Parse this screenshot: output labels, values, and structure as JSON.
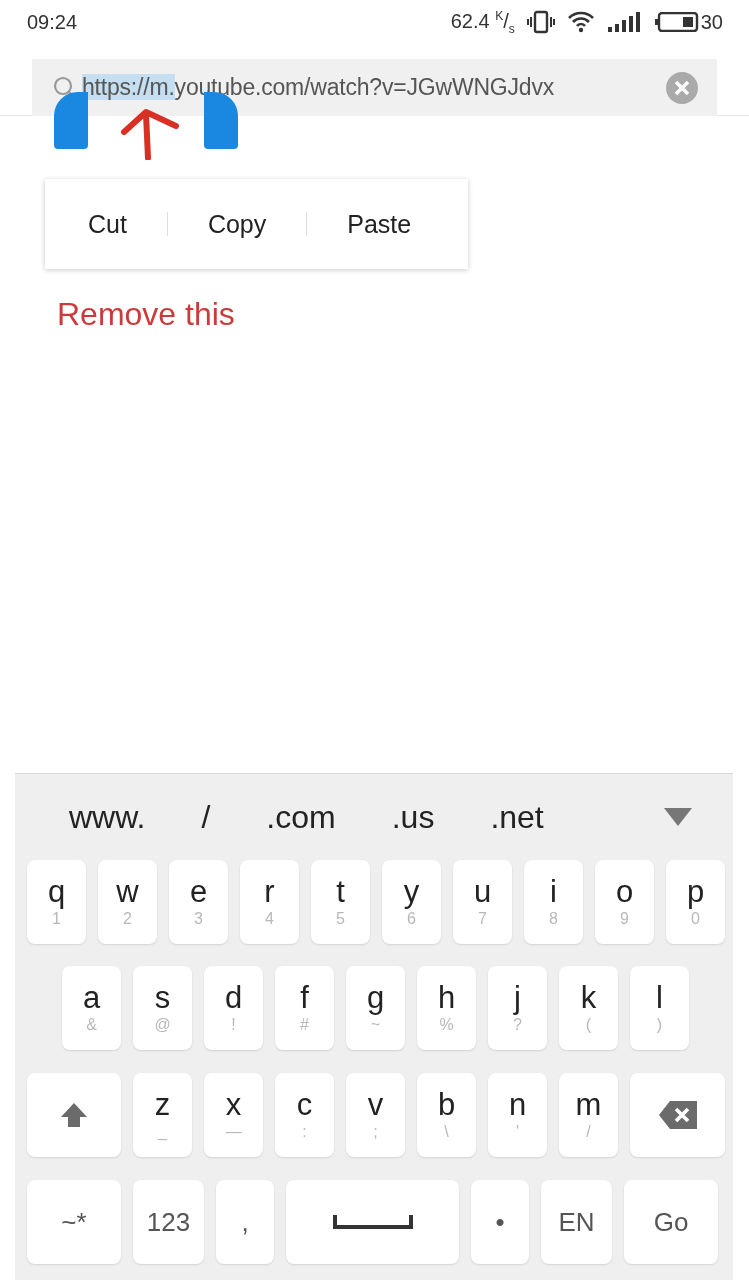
{
  "status_bar": {
    "time": "09:24",
    "speed": "62.4 $^{K}$/$_{s}$",
    "battery": "30"
  },
  "address_bar": {
    "segments": [
      {
        "text": "https://m.",
        "selected": true
      },
      {
        "text": "youtube.com/watch?v=JGwWNGJdvx",
        "selected": false
      }
    ]
  },
  "context_menu": [
    "Cut",
    "Copy",
    "Paste"
  ],
  "annotation": "Remove this",
  "keyboard": {
    "suggestions": [
      "www.",
      "/",
      ".com",
      ".us",
      ".net"
    ],
    "rows": [
      {
        "keys": [
          {
            "kind": "letter",
            "main": "q",
            "sub": "1"
          },
          {
            "kind": "letter",
            "main": "w",
            "sub": "2"
          },
          {
            "kind": "letter",
            "main": "e",
            "sub": "3"
          },
          {
            "kind": "letter",
            "main": "r",
            "sub": "4"
          },
          {
            "kind": "letter",
            "main": "t",
            "sub": "5"
          },
          {
            "kind": "letter",
            "main": "y",
            "sub": "6"
          },
          {
            "kind": "letter",
            "main": "u",
            "sub": "7"
          },
          {
            "kind": "letter",
            "main": "i",
            "sub": "8"
          },
          {
            "kind": "letter",
            "main": "o",
            "sub": "9"
          },
          {
            "kind": "letter",
            "main": "p",
            "sub": "0"
          }
        ]
      },
      {
        "keys": [
          {
            "kind": "letter",
            "main": "a",
            "sub": "&"
          },
          {
            "kind": "letter",
            "main": "s",
            "sub": "@"
          },
          {
            "kind": "letter",
            "main": "d",
            "sub": "!"
          },
          {
            "kind": "letter",
            "main": "f",
            "sub": "#"
          },
          {
            "kind": "letter",
            "main": "g",
            "sub": "~"
          },
          {
            "kind": "letter",
            "main": "h",
            "sub": "%"
          },
          {
            "kind": "letter",
            "main": "j",
            "sub": "?"
          },
          {
            "kind": "letter",
            "main": "k",
            "sub": "("
          },
          {
            "kind": "letter",
            "main": "l",
            "sub": ")"
          }
        ]
      },
      {
        "keys": [
          {
            "kind": "shift"
          },
          {
            "kind": "letter",
            "main": "z",
            "sub": "_"
          },
          {
            "kind": "letter",
            "main": "x",
            "sub": "—"
          },
          {
            "kind": "letter",
            "main": "c",
            "sub": ":"
          },
          {
            "kind": "letter",
            "main": "v",
            "sub": ";"
          },
          {
            "kind": "letter",
            "main": "b",
            "sub": "\\"
          },
          {
            "kind": "letter",
            "main": "n",
            "sub": "'"
          },
          {
            "kind": "letter",
            "main": "m",
            "sub": "/"
          },
          {
            "kind": "backspace"
          }
        ]
      },
      {
        "keys": [
          {
            "kind": "wide",
            "main": "~*"
          },
          {
            "kind": "medium",
            "main": "123"
          },
          {
            "kind": "small",
            "main": ","
          },
          {
            "kind": "space"
          },
          {
            "kind": "small",
            "main": "•"
          },
          {
            "kind": "medium",
            "main": "EN"
          },
          {
            "kind": "wide",
            "main": "Go"
          }
        ]
      }
    ]
  }
}
